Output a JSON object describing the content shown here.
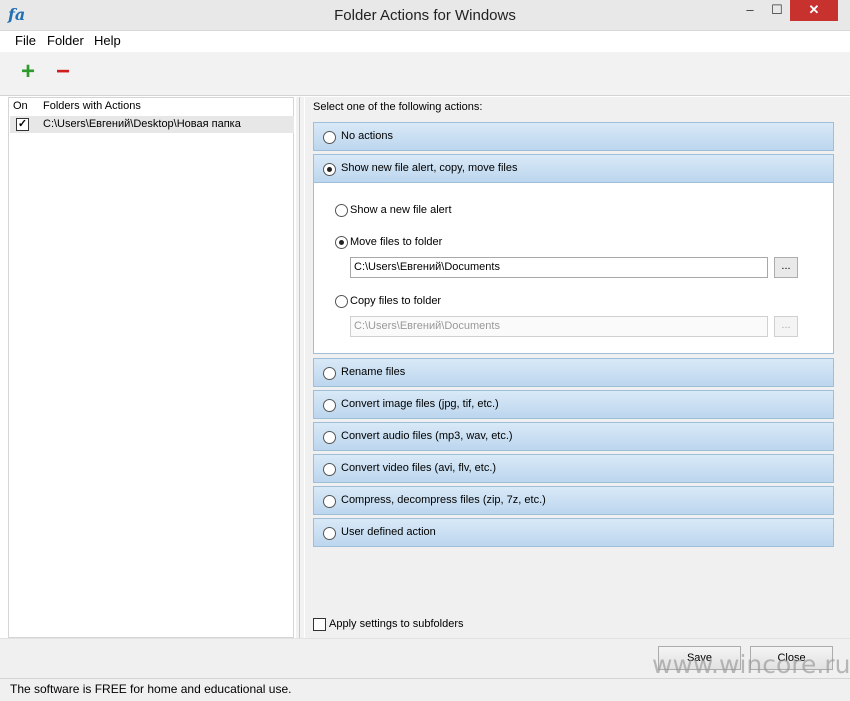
{
  "window": {
    "title": "Folder Actions for Windows",
    "app_icon": "fa",
    "minimize": "‒",
    "maximize": "☐",
    "close": "✕"
  },
  "menu": {
    "file": "File",
    "folder": "Folder",
    "help": "Help"
  },
  "toolbar": {
    "add_icon": "plus-icon",
    "remove_icon": "minus-icon",
    "add_glyph": "+",
    "remove_glyph": "−"
  },
  "folders_list": {
    "col_on": "On",
    "col_folders": "Folders with Actions",
    "rows": [
      {
        "checked": true,
        "check_glyph": "✓",
        "path": "C:\\Users\\Евгений\\Desktop\\Новая папка"
      }
    ]
  },
  "actions": {
    "prompt": "Select one of the following actions:",
    "items": [
      {
        "label": "No actions",
        "selected": false
      },
      {
        "label": "Show new file alert, copy, move files",
        "selected": true
      },
      {
        "label": "Rename files",
        "selected": false
      },
      {
        "label": "Convert image files (jpg, tif, etc.)",
        "selected": false
      },
      {
        "label": "Convert audio files (mp3, wav, etc.)",
        "selected": false
      },
      {
        "label": "Convert video files (avi, flv, etc.)",
        "selected": false
      },
      {
        "label": "Compress, decompress files (zip, 7z, etc.)",
        "selected": false
      },
      {
        "label": "User defined action",
        "selected": false
      }
    ],
    "options": {
      "show_alert": {
        "label": "Show a new file alert",
        "selected": false
      },
      "move": {
        "label": "Move files to folder",
        "selected": true,
        "path": "C:\\Users\\Евгений\\Documents",
        "browse": "..."
      },
      "copy": {
        "label": "Copy files to folder",
        "selected": false,
        "path": "C:\\Users\\Евгений\\Documents",
        "browse": "..."
      }
    },
    "apply_subfolders": {
      "label": "Apply settings to subfolders",
      "checked": false
    }
  },
  "buttons": {
    "save": "Save",
    "close": "Close"
  },
  "watermark": "www.wincore.ru",
  "status": "The software is FREE for home and educational use."
}
